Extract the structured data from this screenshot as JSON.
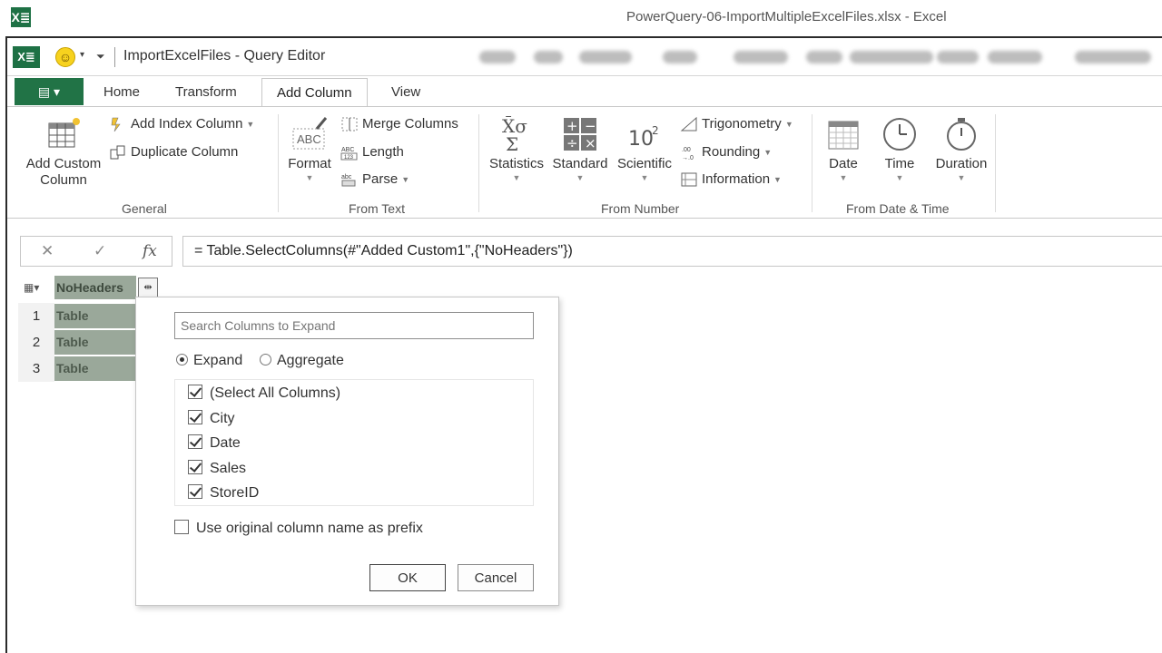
{
  "excel": {
    "logo": "X≣",
    "title": "PowerQuery-06-ImportMultipleExcelFiles.xlsx - Excel"
  },
  "query_editor": {
    "logo": "X≣",
    "title": "ImportExcelFiles - Query Editor"
  },
  "ribbon": {
    "tabs": [
      "Home",
      "Transform",
      "Add Column",
      "View"
    ],
    "active_tab": "Add Column",
    "groups": {
      "general": {
        "label": "General",
        "add_custom_column": [
          "Add Custom",
          "Column"
        ],
        "add_index_column": "Add Index Column",
        "duplicate_column": "Duplicate Column"
      },
      "from_text": {
        "label": "From Text",
        "format": "Format",
        "merge_columns": "Merge Columns",
        "length": "Length",
        "parse": "Parse"
      },
      "from_number": {
        "label": "From Number",
        "statistics": "Statistics",
        "standard": "Standard",
        "scientific": "Scientific",
        "trigonometry": "Trigonometry",
        "rounding": "Rounding",
        "information": "Information"
      },
      "from_date_time": {
        "label": "From Date & Time",
        "date": "Date",
        "time": "Time",
        "duration": "Duration"
      }
    }
  },
  "formula_bar": {
    "cancel": "✕",
    "confirm": "✓",
    "fx": "fx",
    "formula": "= Table.SelectColumns(#\"Added Custom1\",{\"NoHeaders\"})"
  },
  "grid": {
    "column_header": "NoHeaders",
    "rows": [
      {
        "num": "1",
        "value": "Table"
      },
      {
        "num": "2",
        "value": "Table"
      },
      {
        "num": "3",
        "value": "Table"
      }
    ]
  },
  "expand_popup": {
    "search_placeholder": "Search Columns to Expand",
    "mode_expand": "Expand",
    "mode_aggregate": "Aggregate",
    "selected_mode": "Expand",
    "columns": [
      {
        "label": "(Select All Columns)",
        "checked": true
      },
      {
        "label": "City",
        "checked": true
      },
      {
        "label": "Date",
        "checked": true
      },
      {
        "label": "Sales",
        "checked": true
      },
      {
        "label": "StoreID",
        "checked": true
      }
    ],
    "prefix_label": "Use original column name as prefix",
    "prefix_checked": false,
    "ok_label": "OK",
    "cancel_label": "Cancel"
  }
}
